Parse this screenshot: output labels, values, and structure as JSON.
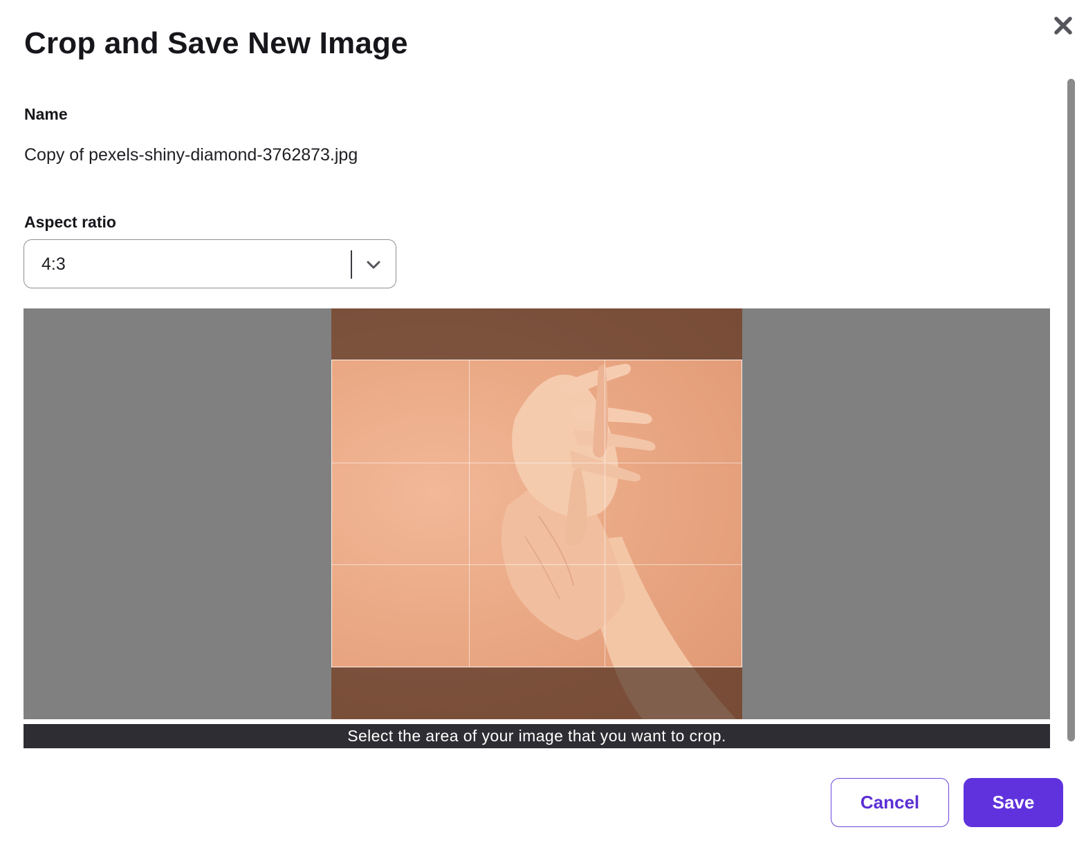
{
  "dialog": {
    "title": "Crop and Save New Image",
    "close_icon": "close-icon"
  },
  "name": {
    "label": "Name",
    "value": "Copy of pexels-shiny-diamond-3762873.jpg"
  },
  "aspect_ratio": {
    "label": "Aspect ratio",
    "selected": "4:3",
    "chevron_icon": "chevron-down-icon"
  },
  "cropper": {
    "hint": "Select the area of your image that you want to crop."
  },
  "actions": {
    "cancel_label": "Cancel",
    "save_label": "Save"
  },
  "colors": {
    "accent": "#5f32dd",
    "hint_bar": "#2d2d33",
    "crop_backdrop": "#808080",
    "photo_background": "#eaa884"
  }
}
